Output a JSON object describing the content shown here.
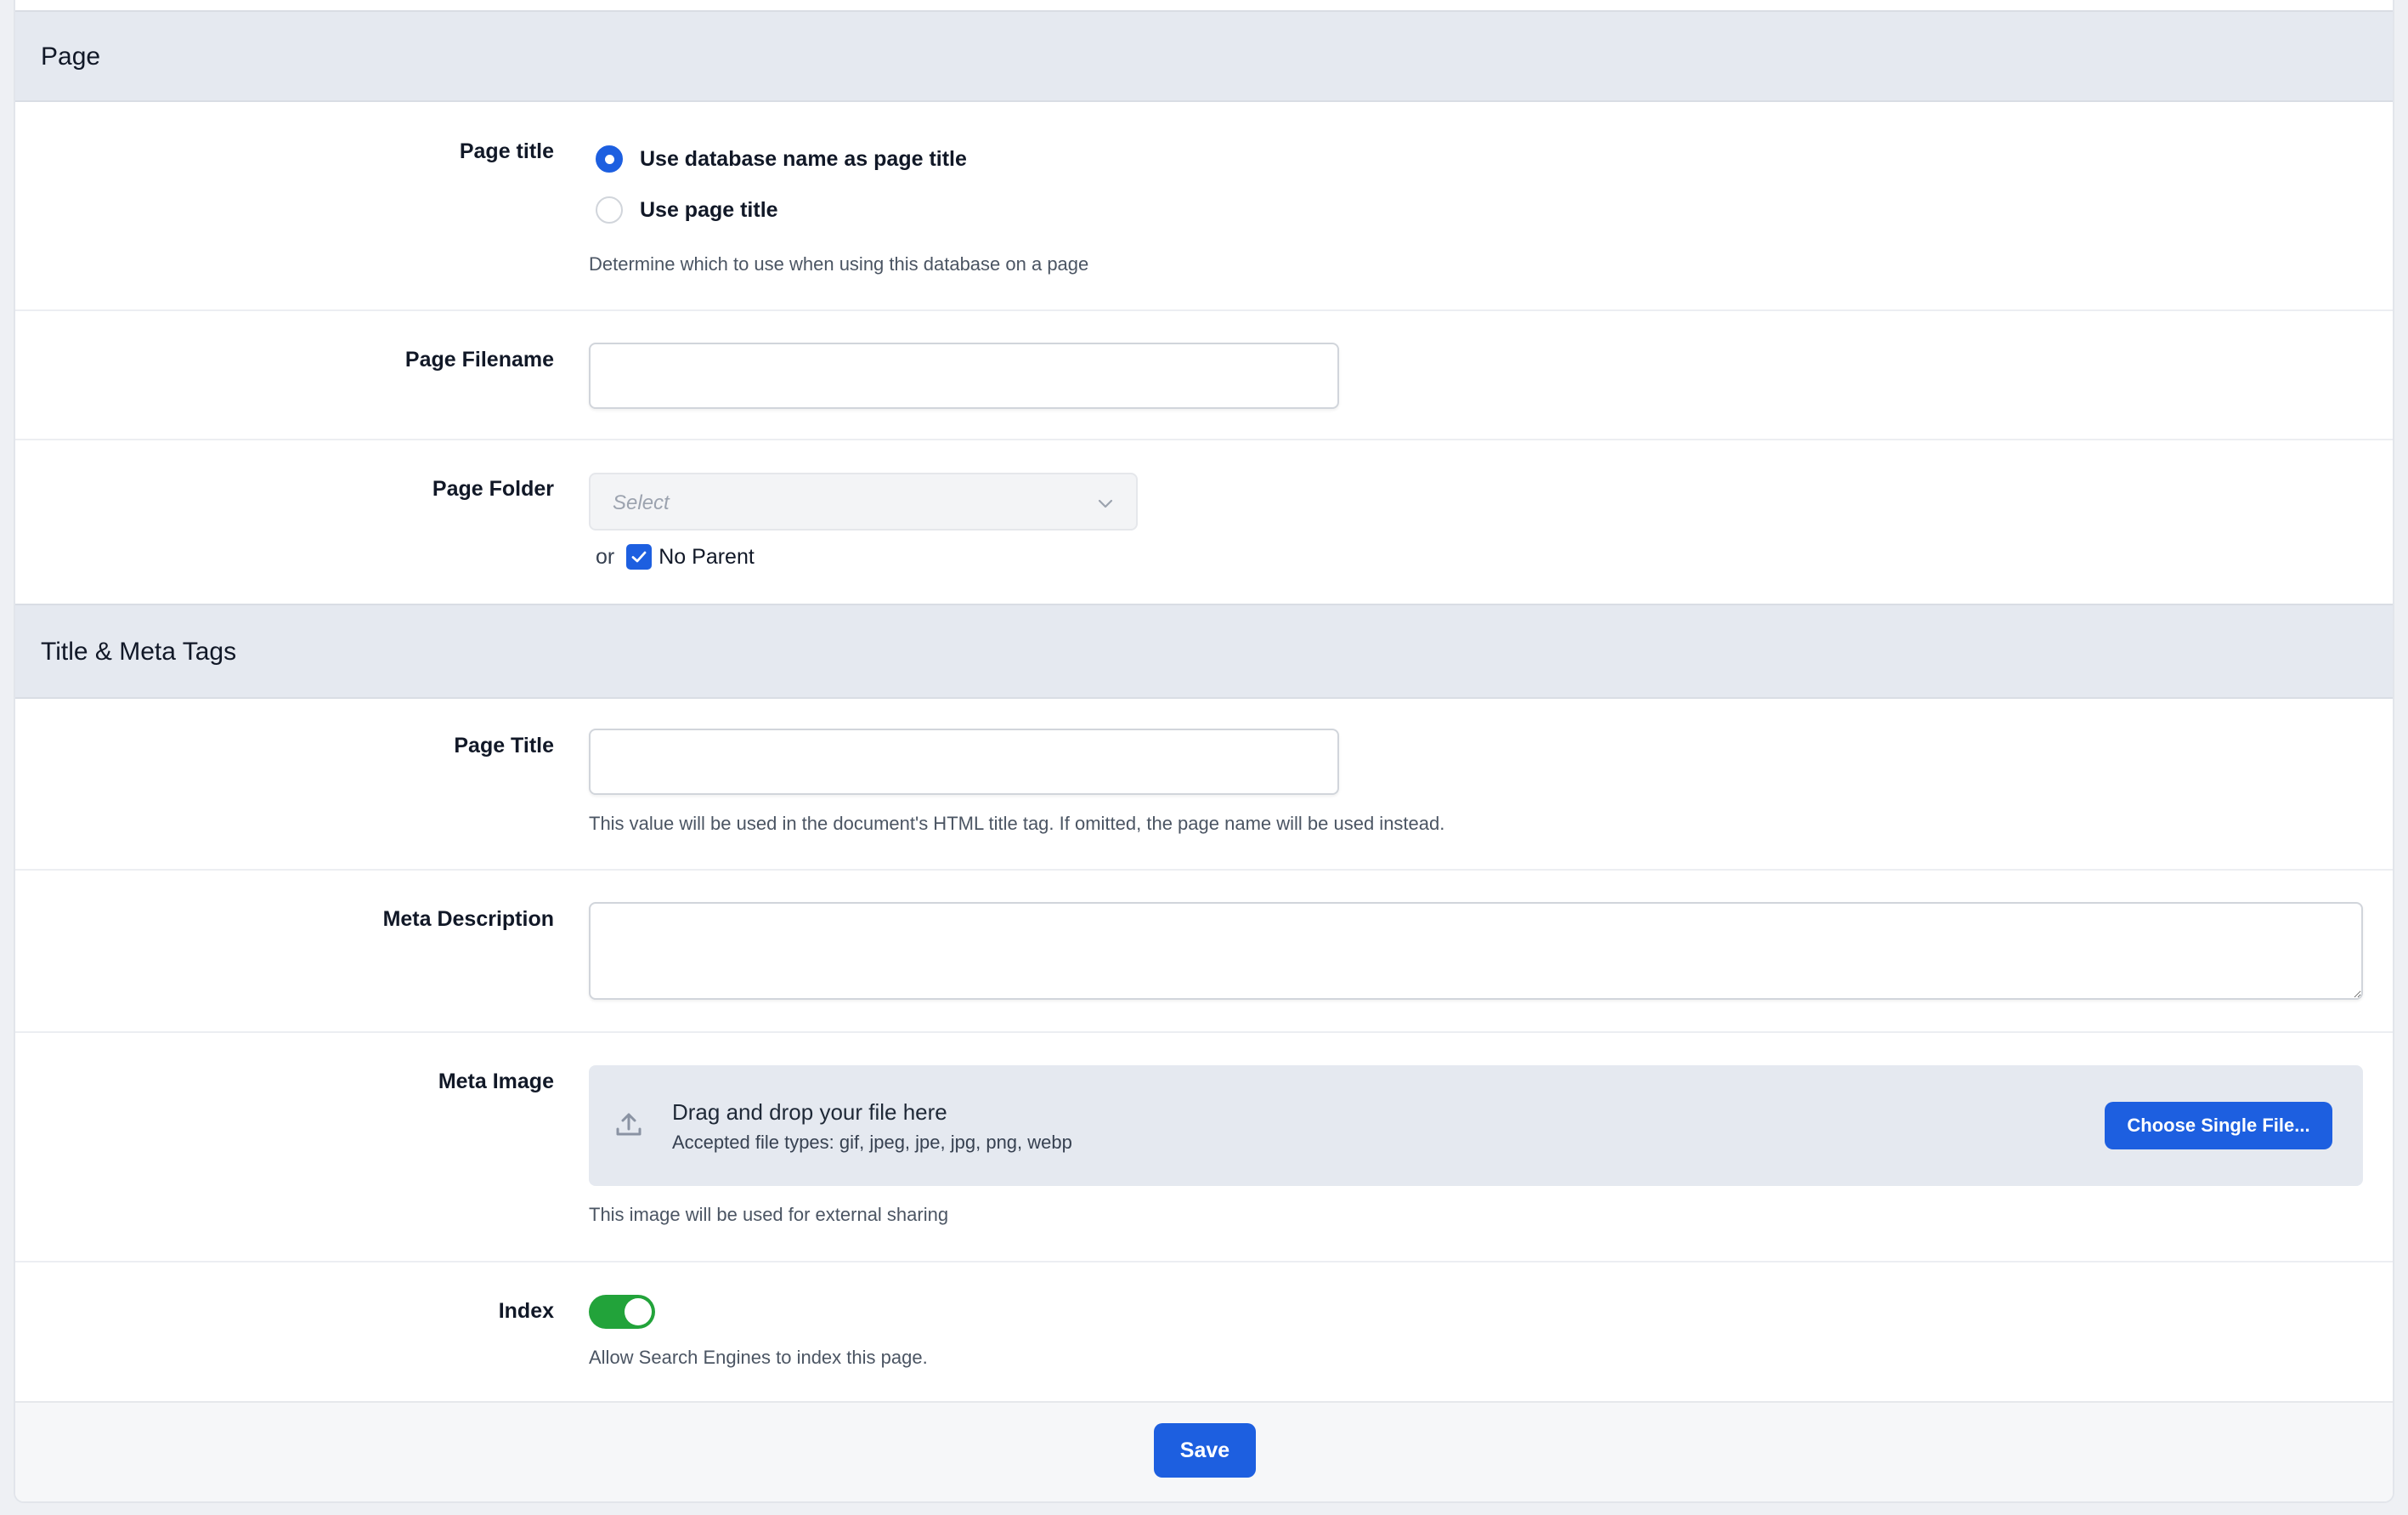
{
  "sections": {
    "page": {
      "title": "Page"
    },
    "meta": {
      "title": "Title & Meta Tags"
    }
  },
  "page_title_field": {
    "label": "Page title",
    "options": [
      "Use database name as page title",
      "Use page title"
    ],
    "selected": "Use database name as page title",
    "help": "Determine which to use when using this database on a page"
  },
  "page_filename": {
    "label": "Page Filename",
    "value": ""
  },
  "page_folder": {
    "label": "Page Folder",
    "placeholder": "Select",
    "or_text": "or",
    "no_parent_label": "No Parent",
    "no_parent_checked": true
  },
  "meta_page_title": {
    "label": "Page Title",
    "value": "",
    "help": "This value will be used in the document's HTML title tag. If omitted, the page name will be used instead."
  },
  "meta_description": {
    "label": "Meta Description",
    "value": ""
  },
  "meta_image": {
    "label": "Meta Image",
    "drop_title": "Drag and drop your file here",
    "accepted": "Accepted file types: gif, jpeg, jpe, jpg, png, webp",
    "button": "Choose Single File...",
    "help": "This image will be used for external sharing"
  },
  "index": {
    "label": "Index",
    "enabled": true,
    "help": "Allow Search Engines to index this page."
  },
  "footer": {
    "save_label": "Save"
  },
  "colors": {
    "primary": "#1d5fe0",
    "toggle_on": "#22a33a",
    "section_bg": "#e5e9f0"
  }
}
